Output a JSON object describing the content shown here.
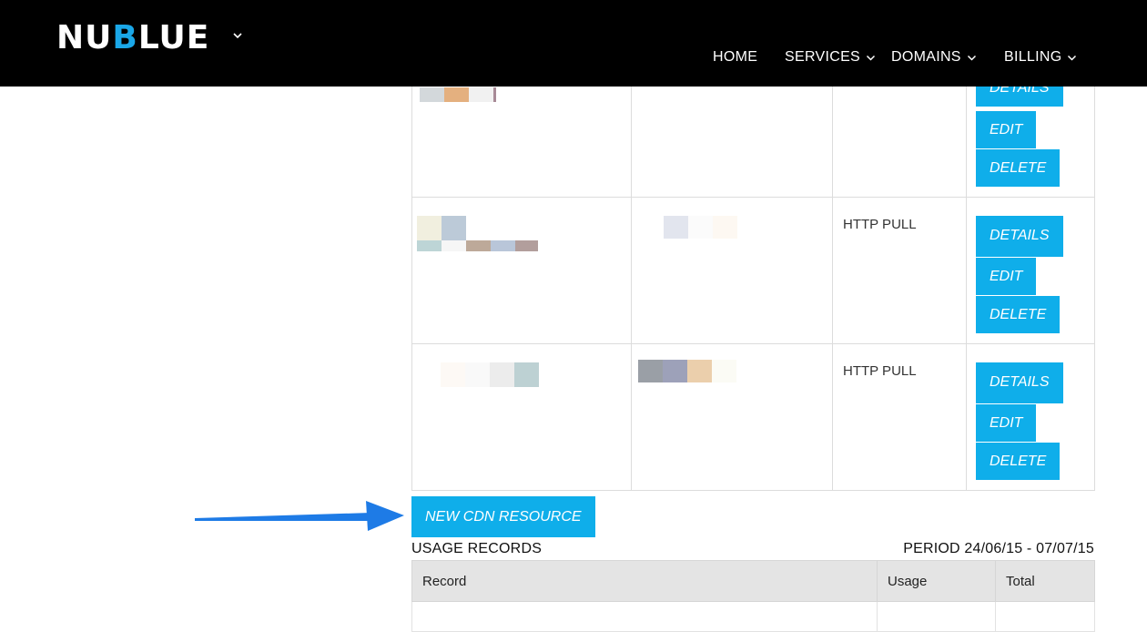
{
  "header": {
    "logo_text_a": "NU",
    "logo_text_b": "B",
    "logo_text_c": "LUE",
    "brand_accent": "#1aa7e8",
    "nav": [
      {
        "label": "HOME",
        "has_dropdown": false
      },
      {
        "label": "SERVICES",
        "has_dropdown": true
      },
      {
        "label": "DOMAINS",
        "has_dropdown": true
      },
      {
        "label": "BILLING",
        "has_dropdown": true
      }
    ]
  },
  "resources": {
    "rows": [
      {
        "type": "",
        "actions": [
          "DETAILS",
          "EDIT",
          "DELETE"
        ]
      },
      {
        "type": "HTTP PULL",
        "actions": [
          "DETAILS",
          "EDIT",
          "DELETE"
        ]
      },
      {
        "type": "HTTP PULL",
        "actions": [
          "DETAILS",
          "EDIT",
          "DELETE"
        ]
      }
    ]
  },
  "new_cdn_label": "NEW CDN RESOURCE",
  "usage": {
    "title": "USAGE RECORDS",
    "period": "PERIOD 24/06/15 - 07/07/15",
    "columns": [
      "Record",
      "Usage",
      "Total"
    ]
  },
  "colors": {
    "button_bg": "#0faeea",
    "header_bg": "#000000",
    "arrow": "#1e7be6"
  }
}
